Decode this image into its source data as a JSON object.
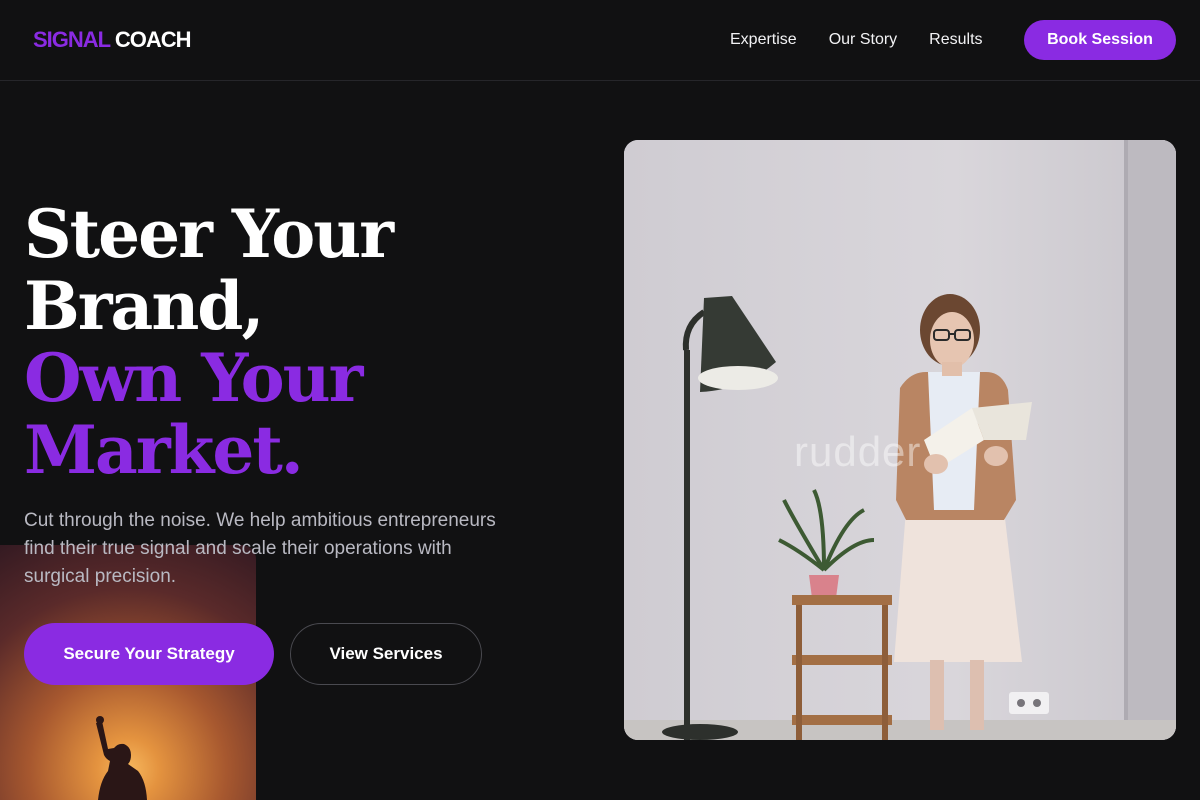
{
  "header": {
    "logo_accent": "SIGNAL",
    "logo_plain": "COACH",
    "nav": [
      {
        "label": "Expertise"
      },
      {
        "label": "Our Story"
      },
      {
        "label": "Results"
      }
    ],
    "book_button": "Book Session"
  },
  "hero": {
    "headline_white_1": "Steer Your",
    "headline_white_2": "Brand,",
    "headline_purple_1": "Own Your",
    "headline_purple_2": "Market.",
    "subtext": "Cut through the noise. We help ambitious entrepreneurs find their true signal and scale their operations with surgical precision.",
    "primary_cta": "Secure Your Strategy",
    "secondary_cta": "View Services",
    "photo_watermark": "rudder"
  },
  "colors": {
    "accent": "#8a2be2",
    "background": "#111112",
    "text_muted": "#b9b9c2"
  }
}
